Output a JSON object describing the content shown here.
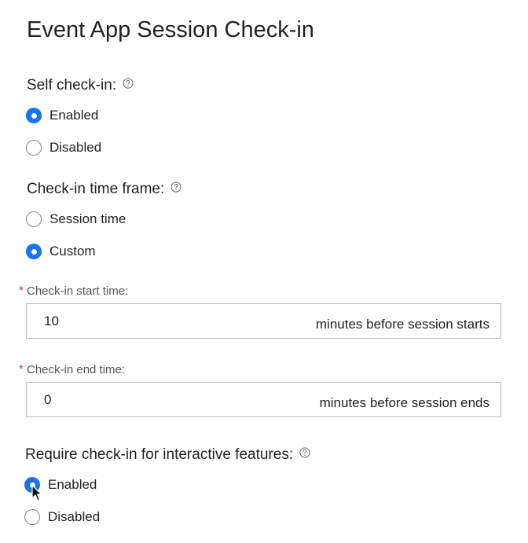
{
  "page": {
    "title": "Event App Session Check-in"
  },
  "self_checkin": {
    "label": "Self check-in:",
    "help_icon": "help-circle-icon",
    "options": [
      {
        "label": "Enabled",
        "selected": true
      },
      {
        "label": "Disabled",
        "selected": false
      }
    ]
  },
  "time_frame": {
    "label": "Check-in time frame:",
    "help_icon": "help-circle-icon",
    "options": [
      {
        "label": "Session time",
        "selected": false
      },
      {
        "label": "Custom",
        "selected": true
      }
    ]
  },
  "start_time": {
    "required_mark": "*",
    "label": "Check-in start time:",
    "value": "10",
    "suffix": "minutes before session starts"
  },
  "end_time": {
    "required_mark": "*",
    "label": "Check-in end time:",
    "value": "0",
    "suffix": "minutes before session ends"
  },
  "interactive": {
    "label": "Require check-in for interactive features:",
    "help_icon": "help-circle-icon",
    "options": [
      {
        "label": "Enabled",
        "selected": true
      },
      {
        "label": "Disabled",
        "selected": false
      }
    ]
  },
  "colors": {
    "accent": "#1a73e8",
    "required": "#d0342c",
    "border": "#b9b9b9"
  }
}
